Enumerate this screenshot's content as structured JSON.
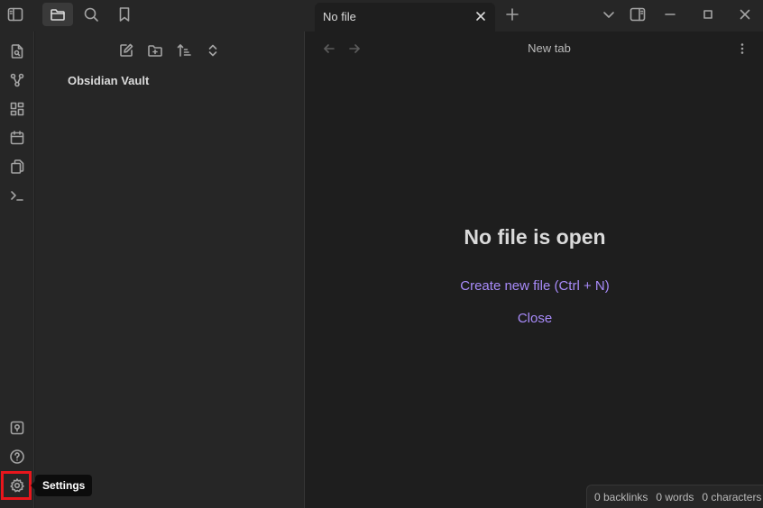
{
  "titlebar": {
    "tab_title": "No file"
  },
  "sidebar": {
    "vault_name": "Obsidian Vault"
  },
  "main": {
    "view_title": "New tab",
    "empty_title": "No file is open",
    "create_file_label": "Create new file (Ctrl + N)",
    "close_label": "Close"
  },
  "statusbar": {
    "backlinks": "0 backlinks",
    "words": "0 words",
    "characters": "0 characters"
  },
  "tooltip": {
    "settings": "Settings"
  },
  "colors": {
    "accent": "#a88bfa",
    "highlight": "#e8161c",
    "background": "#1e1e1e",
    "panel": "#262626"
  }
}
